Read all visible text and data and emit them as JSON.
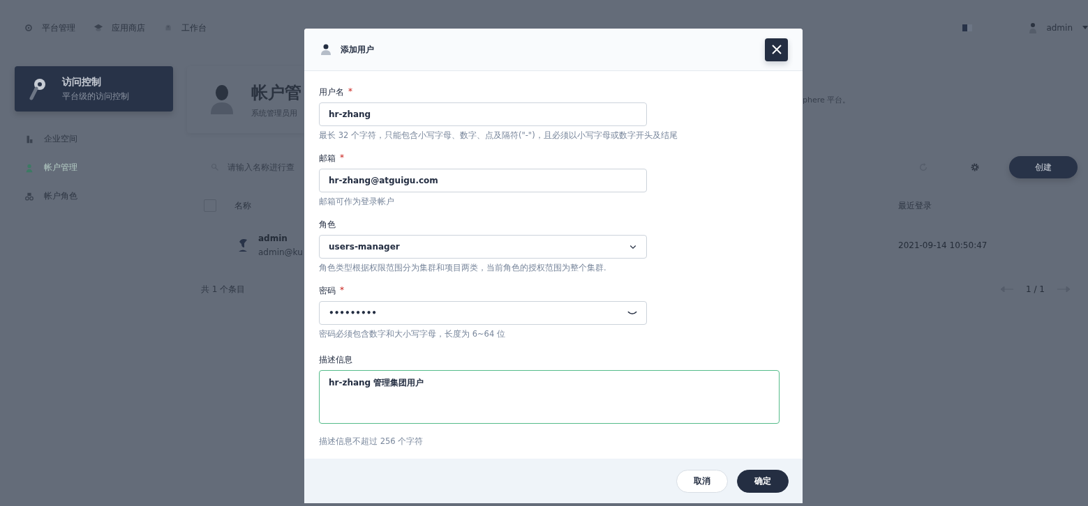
{
  "top_nav": [
    {
      "label": "平台管理"
    },
    {
      "label": "应用商店"
    },
    {
      "label": "工作台"
    }
  ],
  "user_menu": {
    "name": "admin"
  },
  "sidebar": {
    "title": "访问控制",
    "subtitle": "平台级的访问控制",
    "items": [
      {
        "label": "企业空间",
        "selected": false
      },
      {
        "label": "帐户管理",
        "selected": true
      },
      {
        "label": "帐户角色",
        "selected": false
      }
    ]
  },
  "page_header": {
    "title": "帐户管",
    "description": "系统管理员用",
    "description_tail": "phere 平台。"
  },
  "toolbar": {
    "search_placeholder": "请输入名称进行查",
    "create_button": "创建"
  },
  "table": {
    "select_all_checked": false,
    "columns": [
      "名称",
      "最近登录"
    ],
    "rows": [
      {
        "name": "admin",
        "email": "admin@ku",
        "last_login": "2021-09-14 10:50:47"
      }
    ]
  },
  "footer": {
    "total": "共 1 个条目",
    "page": "1 / 1"
  },
  "dialog": {
    "title": "添加用户",
    "fields": [
      {
        "kind": "text",
        "label": "用户名",
        "required_mark": "*",
        "value": "hr-zhang",
        "hint": "最长 32 个字符，只能包含小写字母、数字、点及隔符(\"-\")，且必须以小写字母或数字开头及结尾"
      },
      {
        "kind": "text",
        "label": "邮箱",
        "required_mark": "*",
        "value": "hr-zhang@atguigu.com",
        "hint": "邮箱可作为登录帐户"
      },
      {
        "kind": "select",
        "label": "角色",
        "value": "users-manager",
        "hint": "角色类型根据权限范围分为集群和项目两类，当前角色的授权范围为整个集群."
      },
      {
        "kind": "password",
        "label": "密码",
        "required_mark": "*",
        "value": "•••••••••",
        "hint": "密码必须包含数字和大小写字母，长度为 6~64 位"
      },
      {
        "kind": "textarea",
        "label": "描述信息",
        "value": "hr-zhang 管理集团用户",
        "hint": "描述信息不超过 256 个字符"
      }
    ],
    "buttons": [
      {
        "kind": "secondary",
        "label": "取消"
      },
      {
        "kind": "primary",
        "label": "确定"
      }
    ]
  }
}
